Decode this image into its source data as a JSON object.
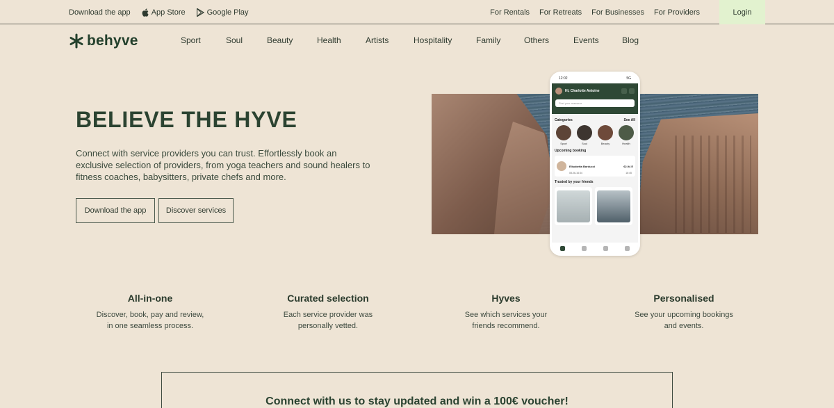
{
  "topbar": {
    "download_app": "Download the app",
    "app_store": "App Store",
    "google_play": "Google Play",
    "links": [
      "For Rentals",
      "For Retreats",
      "For Businesses",
      "For Providers"
    ],
    "login": "Login"
  },
  "brand": {
    "name": "behyve"
  },
  "nav": [
    "Sport",
    "Soul",
    "Beauty",
    "Health",
    "Artists",
    "Hospitality",
    "Family",
    "Others",
    "Events",
    "Blog"
  ],
  "hero": {
    "title": "BELIEVE THE HYVE",
    "text": "Connect with service providers you can trust. Effortlessly book an exclusive selection of providers, from yoga teachers and sound healers to fitness coaches, babysitters, private chefs and more.",
    "btn_download": "Download the app",
    "btn_discover": "Discover services"
  },
  "phone": {
    "time": "12:02",
    "signal": "5G",
    "greeting": "Hi, Charlotte Antoine",
    "search_placeholder": "Find your masseur",
    "categories_label": "Categories",
    "see_all": "See All",
    "categories": [
      "Sport",
      "Soul",
      "Beauty",
      "Health"
    ],
    "upcoming_label": "Upcoming booking",
    "booking_name": "Elisabetta Barducci",
    "booking_price": "€2.94 E",
    "booking_date": "08-06-16:34",
    "booking_time": "16:45",
    "friends_label": "Trusted by your friends"
  },
  "features": [
    {
      "title": "All-in-one",
      "text_1": "Discover, book, pay and review,",
      "text_2": "in one seamless process."
    },
    {
      "title": "Curated selection",
      "text_1": "Each service provider was",
      "text_2": "personally vetted."
    },
    {
      "title": "Hyves",
      "text_1": "See which services your",
      "text_2": "friends recommend."
    },
    {
      "title": "Personalised",
      "text_1": "See your upcoming bookings",
      "text_2": "and events."
    }
  ],
  "newsletter": {
    "title": "Connect with us to stay updated and win a 100€ voucher!"
  },
  "colors": {
    "background": "#eee4d5",
    "brand_green": "#2b4331",
    "login_bg": "#e2f2cf"
  }
}
